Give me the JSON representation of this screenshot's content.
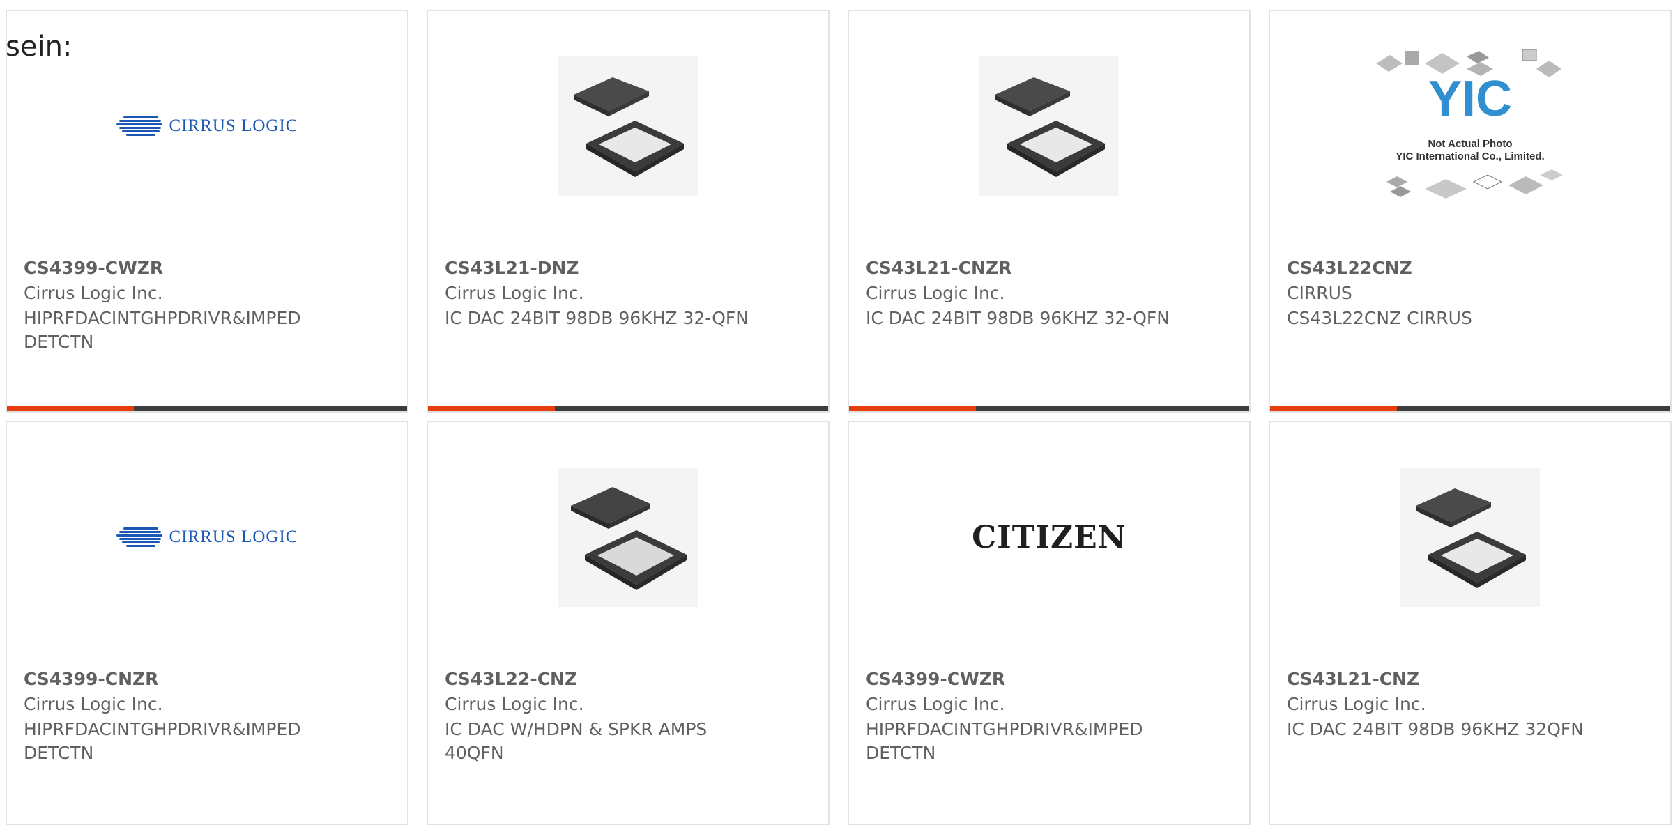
{
  "top_label": "sein:",
  "cards": [
    {
      "part": "CS4399-CWZR",
      "manufacturer": "Cirrus Logic Inc.",
      "description": "HIPRFDACINTGHPDRIVR&IMPED DETCTN",
      "image": "cirrus-logic-logo"
    },
    {
      "part": "CS43L21-DNZ",
      "manufacturer": "Cirrus Logic Inc.",
      "description": "IC DAC 24BIT 98DB 96KHZ 32-QFN",
      "image": "qfn-chip"
    },
    {
      "part": "CS43L21-CNZR",
      "manufacturer": "Cirrus Logic Inc.",
      "description": "IC DAC 24BIT 98DB 96KHZ 32-QFN",
      "image": "qfn-chip"
    },
    {
      "part": "CS43L22CNZ",
      "manufacturer": "CIRRUS",
      "description": "CS43L22CNZ CIRRUS",
      "image": "yic-placeholder",
      "image_text": [
        "Not Actual Photo",
        "YIC International Co., Limited."
      ]
    },
    {
      "part": "CS4399-CNZR",
      "manufacturer": "Cirrus Logic Inc.",
      "description": "HIPRFDACINTGHPDRIVR&IMPED DETCTN",
      "image": "cirrus-logic-logo"
    },
    {
      "part": "CS43L22-CNZ",
      "manufacturer": "Cirrus Logic Inc.",
      "description": "IC DAC W/HDPN & SPKR AMPS 40QFN",
      "image": "qfn-chip"
    },
    {
      "part": "CS4399-CWZR",
      "manufacturer": "Cirrus Logic Inc.",
      "description": "HIPRFDACINTGHPDRIVR&IMPED DETCTN",
      "image": "citizen-logo",
      "image_text": [
        "CITIZEN"
      ]
    },
    {
      "part": "CS43L21-CNZ",
      "manufacturer": "Cirrus Logic Inc.",
      "description": "IC DAC 24BIT 98DB 96KHZ 32QFN",
      "image": "qfn-chip"
    }
  ],
  "logo_text": "CIRRUS LOGIC",
  "colors": {
    "accent": "#e63d0f",
    "bar": "#3d3d3d",
    "border": "#e2e2e2",
    "cirrus_blue": "#1d57b6"
  }
}
